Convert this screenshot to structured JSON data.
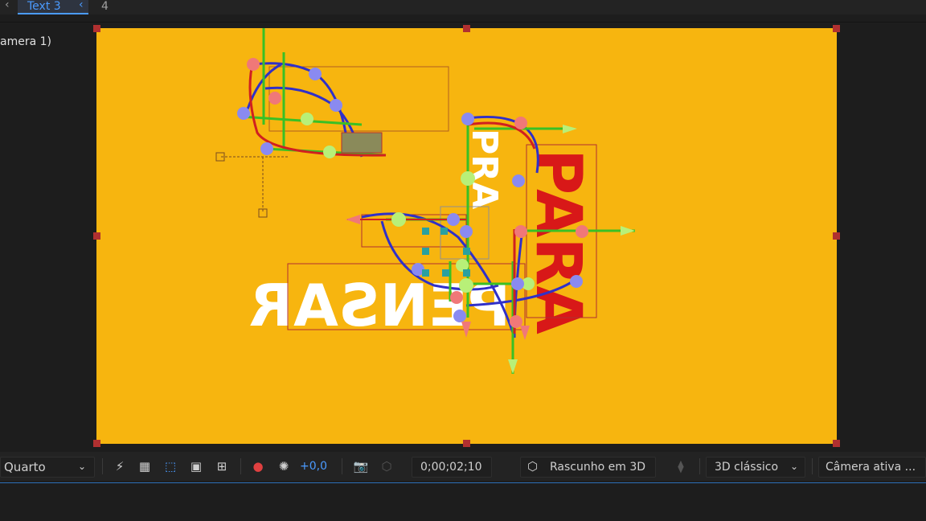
{
  "tabs": {
    "back_arrow": "‹",
    "active_label": "Text 3",
    "prev_arrow": "‹",
    "next_label": "4"
  },
  "viewer": {
    "camera_label": "amera 1)"
  },
  "composition": {
    "background_color": "#f7b50f",
    "texts": {
      "para": "PARA",
      "pensar": "PENSAR",
      "pra": "PRA"
    }
  },
  "toolbar": {
    "resolution": "Quarto",
    "exposure_value": "+0,0",
    "timecode": "0;00;02;10",
    "draft3d_label": "Rascunho em 3D",
    "renderer": "3D clássico",
    "camera_view": "Câmera ativa ..."
  },
  "colors": {
    "accent_blue": "#4b9bff",
    "handle_red": "#b03030"
  }
}
